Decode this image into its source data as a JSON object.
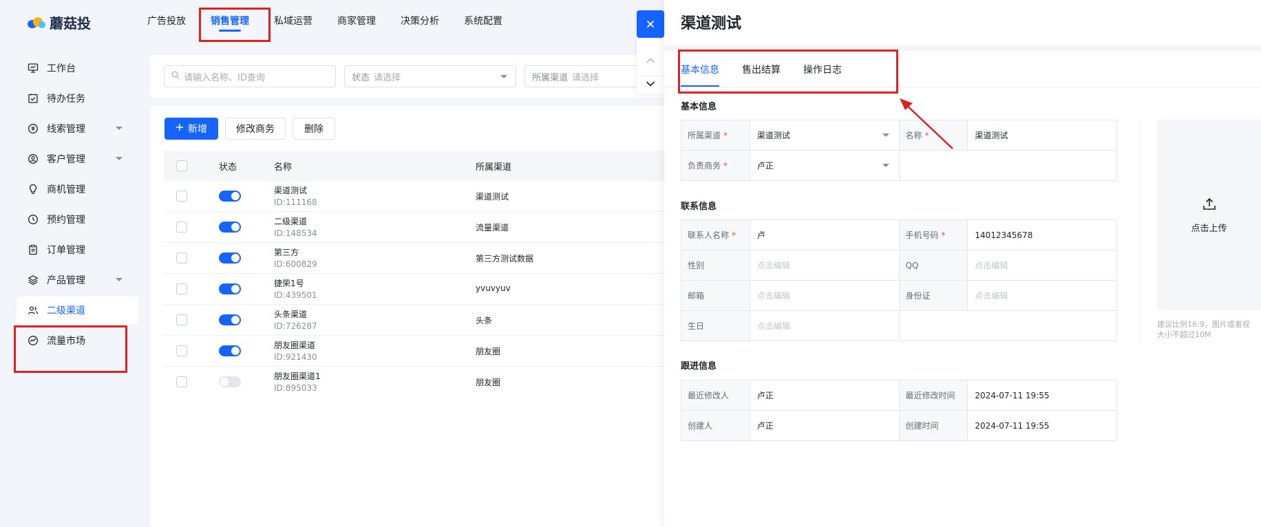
{
  "brand": {
    "name": "蘑菇投"
  },
  "topnav": [
    {
      "label": "广告投放"
    },
    {
      "label": "销售管理",
      "active": true
    },
    {
      "label": "私域运营"
    },
    {
      "label": "商家管理"
    },
    {
      "label": "决策分析"
    },
    {
      "label": "系统配置"
    }
  ],
  "sidebar": {
    "items": [
      {
        "label": "工作台",
        "icon": "monitor-icon"
      },
      {
        "label": "待办任务",
        "icon": "checklist-icon"
      },
      {
        "label": "线索管理",
        "icon": "clue-icon",
        "expandable": true
      },
      {
        "label": "客户管理",
        "icon": "user-circle-icon",
        "expandable": true
      },
      {
        "label": "商机管理",
        "icon": "lightbulb-icon"
      },
      {
        "label": "预约管理",
        "icon": "clock-icon"
      },
      {
        "label": "订单管理",
        "icon": "clipboard-icon"
      },
      {
        "label": "产品管理",
        "icon": "layers-icon",
        "expandable": true
      },
      {
        "label": "二级渠道",
        "icon": "users-icon",
        "active": true
      },
      {
        "label": "流量市场",
        "icon": "gauge-icon"
      }
    ]
  },
  "filters": {
    "search_placeholder": "请输入名称、ID查询",
    "status_label": "状态",
    "status_placeholder": "请选择",
    "channel_label": "所属渠道",
    "channel_placeholder": "请选择"
  },
  "toolbar": {
    "add_label": "新增",
    "edit_bd_label": "修改商务",
    "delete_label": "删除"
  },
  "table": {
    "columns": [
      "状态",
      "名称",
      "所属渠道"
    ],
    "rows": [
      {
        "name": "渠道测试",
        "id": "ID:111168",
        "channel": "渠道测试",
        "enabled": true
      },
      {
        "name": "二级渠道",
        "id": "ID:148534",
        "channel": "流量渠道",
        "enabled": true
      },
      {
        "name": "第三方",
        "id": "ID:600829",
        "channel": "第三方测试数据",
        "enabled": true
      },
      {
        "name": "捷荣1号",
        "id": "ID:439501",
        "channel": "yvuvyuv",
        "enabled": true
      },
      {
        "name": "头条渠道",
        "id": "ID:726287",
        "channel": "头条",
        "enabled": true
      },
      {
        "name": "朋友圈渠道",
        "id": "ID:921430",
        "channel": "朋友圈",
        "enabled": true
      },
      {
        "name": "朋友圈渠道1",
        "id": "ID:895033",
        "channel": "朋友圈",
        "enabled": false
      }
    ]
  },
  "drawer": {
    "title": "渠道测试",
    "tabs": [
      {
        "label": "基本信息",
        "active": true
      },
      {
        "label": "售出结算"
      },
      {
        "label": "操作日志"
      }
    ],
    "basic": {
      "section": "基本信息",
      "channel_label": "所属渠道",
      "channel_value": "渠道测试",
      "name_label": "名称",
      "name_value": "渠道测试",
      "bd_label": "负责商务",
      "bd_value": "卢正"
    },
    "contact": {
      "section": "联系信息",
      "contact_name_label": "联系人名称",
      "contact_name_value": "卢",
      "phone_label": "手机号码",
      "phone_value": "14012345678",
      "gender_label": "性别",
      "qq_label": "QQ",
      "email_label": "邮箱",
      "idcard_label": "身份证",
      "birthday_label": "生日",
      "edit_placeholder": "点击编辑"
    },
    "followup": {
      "section": "跟进信息",
      "modifier_label": "最近修改人",
      "modifier_value": "卢正",
      "modified_time_label": "最近修改时间",
      "modified_time_value": "2024-07-11 19:55",
      "creator_label": "创建人",
      "creator_value": "卢正",
      "created_time_label": "创建时间",
      "created_time_value": "2024-07-11 19:55"
    },
    "upload": {
      "label": "点击上传",
      "hint_line1": "建议比例16:9，图片或者视",
      "hint_line2": "大小不超过10M"
    }
  },
  "colors": {
    "primary": "#1664ff",
    "annotation": "#e02020",
    "required": "#f54a45"
  }
}
